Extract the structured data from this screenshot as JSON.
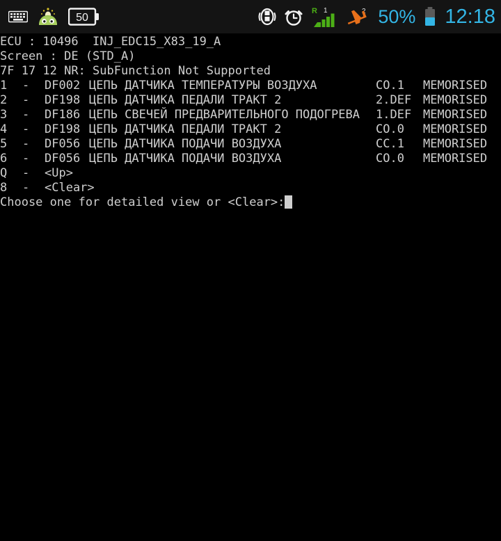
{
  "status_bar": {
    "left_icons": [
      {
        "name": "keyboard-icon",
        "label": "keyboard"
      },
      {
        "name": "droid-app-icon",
        "label": "android-app"
      },
      {
        "name": "battery-percent-badge-icon",
        "label": "50"
      }
    ],
    "right_icons": [
      {
        "name": "vibrate-icon",
        "label": "vibrate"
      },
      {
        "name": "alarm-clock-icon",
        "label": "alarm"
      },
      {
        "name": "signal-bars-icon",
        "label": "signal",
        "roaming": "R",
        "sim": "1"
      },
      {
        "name": "airplane-mode-icon",
        "label": "airplane",
        "sim": "2"
      }
    ],
    "battery_percent": "50%",
    "clock": "12:18",
    "accent_color": "#33b5e5",
    "signal_color": "#4caf16",
    "airplane_color": "#e8701a",
    "background": "#141414"
  },
  "terminal": {
    "foreground": "#cfcfcf",
    "background": "#000000",
    "header": {
      "ecu_line": "ECU : 10496  INJ_EDC15_X83_19_A",
      "screen_line": "Screen : DE (STD_A)",
      "error_line": "7F 17 12 NR: SubFunction Not Supported"
    },
    "columns": {
      "index": "",
      "dash": "-",
      "code": "",
      "description": "",
      "status": "",
      "memory": ""
    },
    "rows": [
      {
        "index": "1",
        "dash": "-",
        "code": "DF002",
        "description": "ЦЕПЬ ДАТЧИКА ТЕМПЕРАТУРЫ ВОЗДУХА",
        "status": "CO.1",
        "memory": "MEMORISED"
      },
      {
        "index": "2",
        "dash": "-",
        "code": "DF198",
        "description": "ЦЕПЬ ДАТЧИКА ПЕДАЛИ ТРАКТ 2",
        "status": "2.DEF",
        "memory": "MEMORISED"
      },
      {
        "index": "3",
        "dash": "-",
        "code": "DF186",
        "description": "ЦЕПЬ СВЕЧЕЙ ПРЕДВАРИТЕЛЬНОГО ПОДОГРЕВА",
        "status": "1.DEF",
        "memory": "MEMORISED"
      },
      {
        "index": "4",
        "dash": "-",
        "code": "DF198",
        "description": "ЦЕПЬ ДАТЧИКА ПЕДАЛИ ТРАКТ 2",
        "status": "CO.0",
        "memory": "MEMORISED"
      },
      {
        "index": "5",
        "dash": "-",
        "code": "DF056",
        "description": "ЦЕПЬ ДАТЧИКА ПОДАЧИ ВОЗДУХА",
        "status": "CC.1",
        "memory": "MEMORISED"
      },
      {
        "index": "6",
        "dash": "-",
        "code": "DF056",
        "description": "ЦЕПЬ ДАТЧИКА ПОДАЧИ ВОЗДУХА",
        "status": "CO.0",
        "memory": "MEMORISED"
      }
    ],
    "menu": [
      {
        "key": "Q",
        "dash": "-",
        "label": "<Up>"
      },
      {
        "key": "8",
        "dash": "-",
        "label": "<Clear>"
      }
    ],
    "prompt": "Choose one for detailed view or <Clear>:"
  }
}
